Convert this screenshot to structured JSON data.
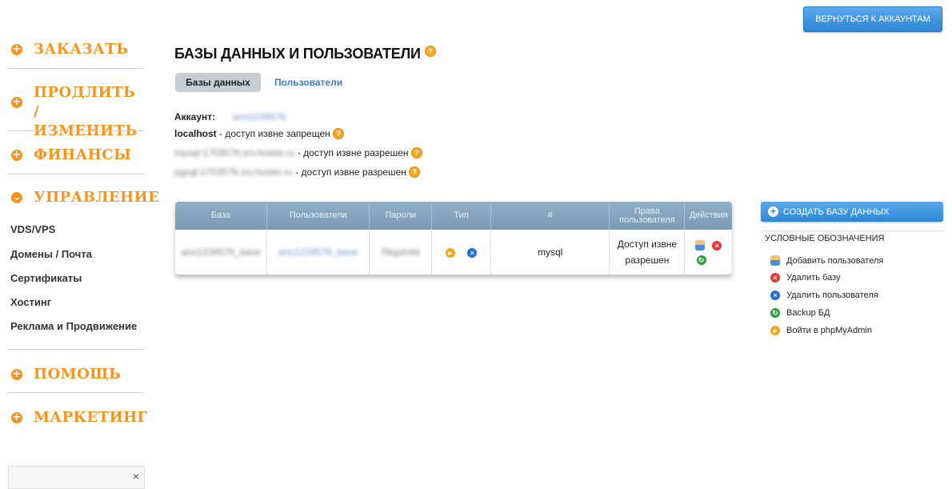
{
  "header": {
    "back_button": "Вернуться к аккаунтам"
  },
  "sidebar": {
    "sections": [
      {
        "label": "ЗАКАЗАТЬ"
      },
      {
        "label": "ПРОДЛИТЬ / ИЗМЕНИТЬ"
      },
      {
        "label": "ФИНАНСЫ"
      },
      {
        "label": "УПРАВЛЕНИЕ"
      },
      {
        "label": "ПОМОЩЬ"
      },
      {
        "label": "МАРКЕТИНГ"
      }
    ],
    "sub_items": [
      "VDS/VPS",
      "Домены / Почта",
      "Сертификаты",
      "Хостинг",
      "Реклама и Продвижение"
    ],
    "chat_close": "×"
  },
  "main": {
    "title": "БАЗЫ ДАННЫХ И ПОЛЬЗОВАТЕЛИ",
    "tabs": {
      "databases": "Базы данных",
      "users": "Пользователи"
    },
    "account_label": "Аккаунт:",
    "account_value": "ann1234576",
    "hosts": [
      {
        "host": "localhost",
        "status": " - доступ извне запрещен"
      },
      {
        "host": "mysql-1703576.srv.hoster.ru",
        "status": " - доступ извне разрешен"
      },
      {
        "host": "pgsql-1703576.srv.hoster.ru",
        "status": " - доступ извне разрешен"
      }
    ],
    "table": {
      "headers": [
        "База",
        "Пользователи",
        "Пароли",
        "Тип",
        "#",
        "Права пользователя",
        "Действия"
      ],
      "rows": [
        {
          "base": "ann1234576_base",
          "users": "ann1234576_base",
          "password": "Rkgsh4d",
          "engine": "mysql",
          "rights": "Доступ извне разрешен"
        }
      ]
    }
  },
  "right_panel": {
    "create_button": "Создать базу данных",
    "legend_title": "Условные обозначения",
    "legend": [
      {
        "icon": "user-add-icon",
        "label": "Добавить пользователя"
      },
      {
        "icon": "delete-db-icon",
        "label": "Удалить базу"
      },
      {
        "icon": "delete-user-icon",
        "label": "Удалить пользователя"
      },
      {
        "icon": "backup-icon",
        "label": "Backup БД"
      },
      {
        "icon": "phpmyadmin-icon",
        "label": "Войти в phpMyAdmin"
      }
    ]
  },
  "colors": {
    "accent_orange": "#f7941d",
    "button_blue": "#2e86d6",
    "table_header": "#7a9bb4"
  }
}
